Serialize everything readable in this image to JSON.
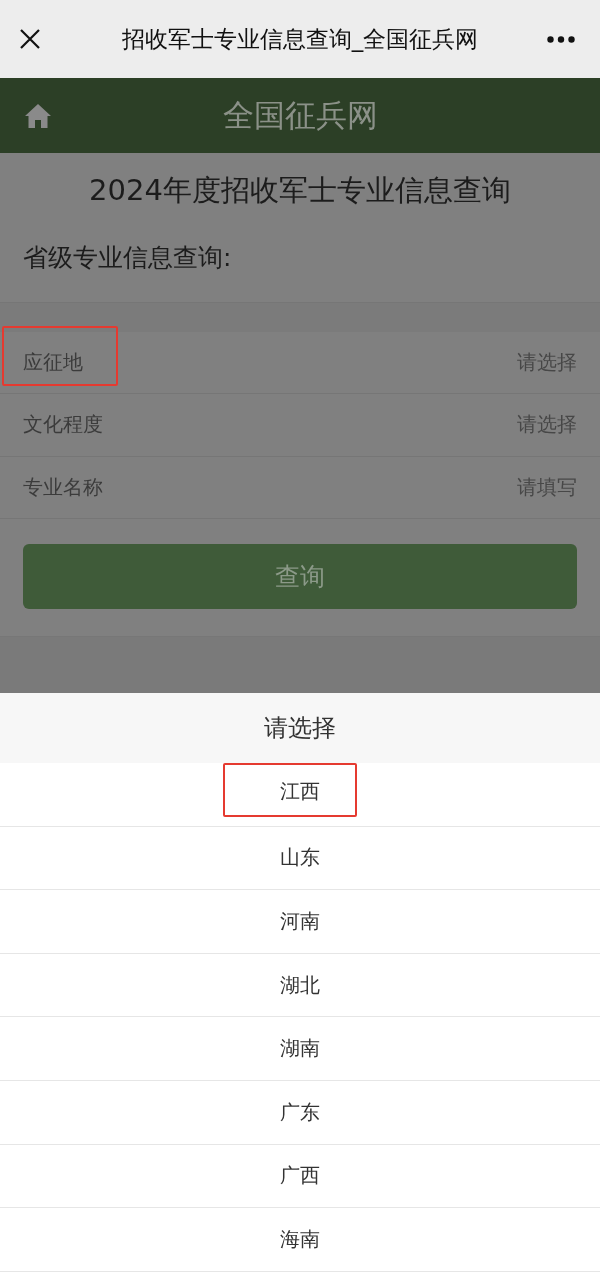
{
  "browser_bar": {
    "title": "招收军士专业信息查询_全国征兵网"
  },
  "site_header": {
    "title": "全国征兵网"
  },
  "page": {
    "heading": "2024年度招收军士专业信息查询",
    "section_title": "省级专业信息查询:"
  },
  "form": {
    "fields": [
      {
        "kind": "select",
        "label": "应征地",
        "placeholder": "请选择",
        "highlighted": true
      },
      {
        "kind": "select",
        "label": "文化程度",
        "placeholder": "请选择",
        "highlighted": false
      },
      {
        "kind": "text",
        "label": "专业名称",
        "placeholder": "请填写",
        "highlighted": false
      }
    ],
    "submit": "查询"
  },
  "picker": {
    "title": "请选择",
    "options": [
      {
        "label": "江西",
        "highlighted": true
      },
      {
        "label": "山东",
        "highlighted": false
      },
      {
        "label": "河南",
        "highlighted": false
      },
      {
        "label": "湖北",
        "highlighted": false
      },
      {
        "label": "湖南",
        "highlighted": false
      },
      {
        "label": "广东",
        "highlighted": false
      },
      {
        "label": "广西",
        "highlighted": false
      },
      {
        "label": "海南",
        "highlighted": false
      }
    ]
  }
}
